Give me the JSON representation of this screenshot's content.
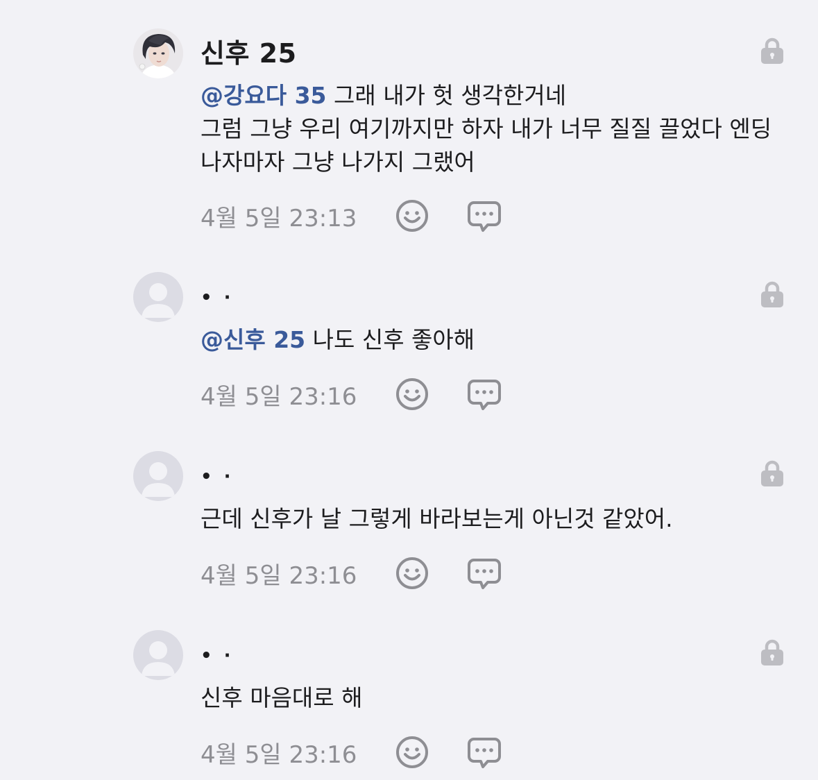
{
  "comments": [
    {
      "author": "신후 25",
      "avatar": "avatar-photo",
      "mention": "@강요다 35",
      "lines": [
        "그래 내가 헛 생각한거네",
        "그럼 그냥 우리 여기까지만 하자 내가 너무 질질 끌었다 엔딩",
        "나자마자 그냥 나가지 그랬어"
      ],
      "time": "4월 5일 23:13"
    },
    {
      "author": "• ·",
      "avatar": "default-avatar",
      "mention": "@신후 25",
      "lines": [
        "나도 신후 좋아해"
      ],
      "time": "4월 5일 23:16"
    },
    {
      "author": "• ·",
      "avatar": "default-avatar",
      "mention": "",
      "lines": [
        "근데 신후가 날 그렇게 바라보는게 아닌것 같았어."
      ],
      "time": "4월 5일 23:16"
    },
    {
      "author": "• ·",
      "avatar": "default-avatar",
      "mention": "",
      "lines": [
        "신후 마음대로 해"
      ],
      "time": "4월 5일 23:16"
    }
  ],
  "icons": {
    "lock": "lock-icon",
    "emoji": "smiley-icon",
    "reply": "speech-bubble-icon"
  },
  "colors": {
    "background": "#f2f2f6",
    "mention": "#3a5a9a",
    "icon": "#bdbdc2",
    "meta": "#8e8e93"
  }
}
